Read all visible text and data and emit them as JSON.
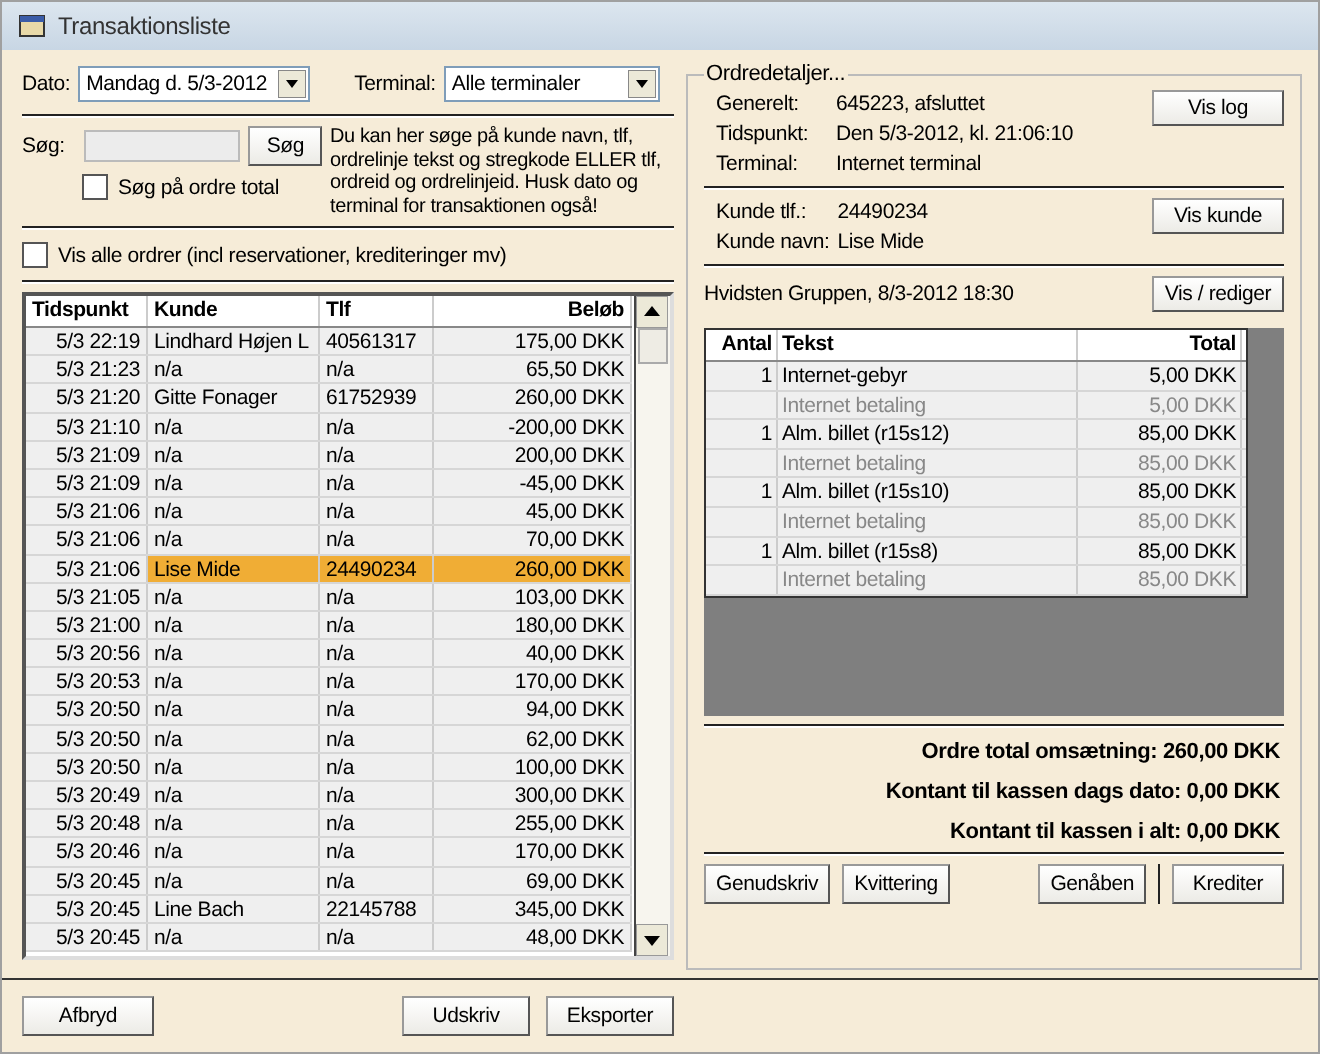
{
  "window": {
    "title": "Transaktionsliste"
  },
  "filters": {
    "date": {
      "label": "Dato:",
      "value": "Mandag d. 5/3-2012"
    },
    "terminal": {
      "label": "Terminal:",
      "value": "Alle terminaler"
    }
  },
  "search": {
    "label": "Søg:",
    "button": "Søg",
    "total_checkbox": {
      "label": "Søg på ordre total",
      "checked": false
    },
    "help": "Du kan her søge på kunde navn, tlf, ordrelinje tekst og stregkode ELLER tlf, ordreid og ordrelinjeid. Husk dato og terminal for transaktionen også!"
  },
  "show_all": {
    "label": "Vis alle ordrer (incl reservationer, krediteringer mv)",
    "checked": false
  },
  "transactions": {
    "columns": [
      "Tidspunkt",
      "Kunde",
      "Tlf",
      "Beløb"
    ],
    "rows": [
      {
        "time": "5/3 22:19",
        "customer": "Lindhard Højen L",
        "phone": "40561317",
        "amount": "175,00 DKK",
        "selected": false
      },
      {
        "time": "5/3 21:23",
        "customer": "n/a",
        "phone": "n/a",
        "amount": "65,50 DKK",
        "selected": false
      },
      {
        "time": "5/3 21:20",
        "customer": "Gitte Fonager",
        "phone": "61752939",
        "amount": "260,00 DKK",
        "selected": false
      },
      {
        "time": "5/3 21:10",
        "customer": "n/a",
        "phone": "n/a",
        "amount": "-200,00 DKK",
        "selected": false
      },
      {
        "time": "5/3 21:09",
        "customer": "n/a",
        "phone": "n/a",
        "amount": "200,00 DKK",
        "selected": false
      },
      {
        "time": "5/3 21:09",
        "customer": "n/a",
        "phone": "n/a",
        "amount": "-45,00 DKK",
        "selected": false
      },
      {
        "time": "5/3 21:06",
        "customer": "n/a",
        "phone": "n/a",
        "amount": "45,00 DKK",
        "selected": false
      },
      {
        "time": "5/3 21:06",
        "customer": "n/a",
        "phone": "n/a",
        "amount": "70,00 DKK",
        "selected": false
      },
      {
        "time": "5/3 21:06",
        "customer": "Lise Mide",
        "phone": "24490234",
        "amount": "260,00 DKK",
        "selected": true
      },
      {
        "time": "5/3 21:05",
        "customer": "n/a",
        "phone": "n/a",
        "amount": "103,00 DKK",
        "selected": false
      },
      {
        "time": "5/3 21:00",
        "customer": "n/a",
        "phone": "n/a",
        "amount": "180,00 DKK",
        "selected": false
      },
      {
        "time": "5/3 20:56",
        "customer": "n/a",
        "phone": "n/a",
        "amount": "40,00 DKK",
        "selected": false
      },
      {
        "time": "5/3 20:53",
        "customer": "n/a",
        "phone": "n/a",
        "amount": "170,00 DKK",
        "selected": false
      },
      {
        "time": "5/3 20:50",
        "customer": "n/a",
        "phone": "n/a",
        "amount": "94,00 DKK",
        "selected": false
      },
      {
        "time": "5/3 20:50",
        "customer": "n/a",
        "phone": "n/a",
        "amount": "62,00 DKK",
        "selected": false
      },
      {
        "time": "5/3 20:50",
        "customer": "n/a",
        "phone": "n/a",
        "amount": "100,00 DKK",
        "selected": false
      },
      {
        "time": "5/3 20:49",
        "customer": "n/a",
        "phone": "n/a",
        "amount": "300,00 DKK",
        "selected": false
      },
      {
        "time": "5/3 20:48",
        "customer": "n/a",
        "phone": "n/a",
        "amount": "255,00 DKK",
        "selected": false
      },
      {
        "time": "5/3 20:46",
        "customer": "n/a",
        "phone": "n/a",
        "amount": "170,00 DKK",
        "selected": false
      },
      {
        "time": "5/3 20:45",
        "customer": "n/a",
        "phone": "n/a",
        "amount": "69,00 DKK",
        "selected": false
      },
      {
        "time": "5/3 20:45",
        "customer": "Line Bach",
        "phone": "22145788",
        "amount": "345,00 DKK",
        "selected": false
      },
      {
        "time": "5/3 20:45",
        "customer": "n/a",
        "phone": "n/a",
        "amount": "48,00 DKK",
        "selected": false
      }
    ]
  },
  "order_details": {
    "title": "Ordredetaljer...",
    "general": [
      {
        "label": "Generelt:",
        "value": "645223, afsluttet"
      },
      {
        "label": "Tidspunkt:",
        "value": "Den 5/3-2012, kl. 21:06:10"
      },
      {
        "label": "Terminal:",
        "value": "Internet terminal"
      }
    ],
    "log_button": "Vis log",
    "customer": [
      {
        "label": "Kunde tlf.:",
        "value": "24490234"
      },
      {
        "label": "Kunde navn:",
        "value": "Lise Mide"
      }
    ],
    "customer_button": "Vis kunde",
    "event": "Hvidsten Gruppen, 8/3-2012 18:30",
    "event_button": "Vis / rediger",
    "line_columns": [
      "Antal",
      "Tekst",
      "Total"
    ],
    "lines": [
      {
        "kind": "item",
        "qty": "1",
        "text": "Internet-gebyr",
        "total": "5,00 DKK"
      },
      {
        "kind": "payment",
        "text": "Internet betaling",
        "total": "5,00 DKK"
      },
      {
        "kind": "item",
        "qty": "1",
        "text": "Alm. billet (r15s12)",
        "total": "85,00 DKK"
      },
      {
        "kind": "payment",
        "text": "Internet betaling",
        "total": "85,00 DKK"
      },
      {
        "kind": "item",
        "qty": "1",
        "text": "Alm. billet (r15s10)",
        "total": "85,00 DKK"
      },
      {
        "kind": "payment",
        "text": "Internet betaling",
        "total": "85,00 DKK"
      },
      {
        "kind": "item",
        "qty": "1",
        "text": "Alm. billet (r15s8)",
        "total": "85,00 DKK"
      },
      {
        "kind": "payment",
        "text": "Internet betaling",
        "total": "85,00 DKK"
      }
    ],
    "totals": [
      "Ordre total omsætning: 260,00 DKK",
      "Kontant til kassen dags dato: 0,00 DKK",
      "Kontant til kassen i alt: 0,00 DKK"
    ],
    "buttons": [
      "Genudskriv",
      "Kvittering",
      "Genåben",
      "Krediter"
    ]
  },
  "footer_buttons": [
    "Afbryd",
    "Udskriv",
    "Eksporter"
  ]
}
